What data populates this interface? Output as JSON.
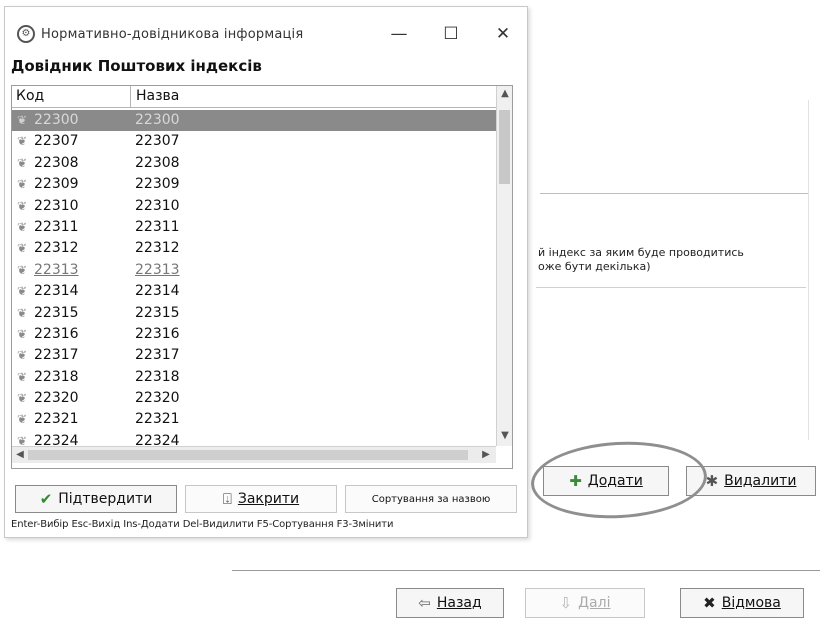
{
  "dialog": {
    "title": "Нормативно-довідникова інформація",
    "heading": "Довідник Поштових індексів",
    "window_controls": {
      "minimize": "—",
      "maximize": "☐",
      "close": "✕"
    },
    "columns": {
      "code": "Код",
      "name": "Назва"
    },
    "rows": [
      {
        "code": "22300",
        "name": "22300",
        "state": "selected"
      },
      {
        "code": "22307",
        "name": "22307"
      },
      {
        "code": "22308",
        "name": "22308"
      },
      {
        "code": "22309",
        "name": "22309"
      },
      {
        "code": "22310",
        "name": "22310"
      },
      {
        "code": "22311",
        "name": "22311"
      },
      {
        "code": "22312",
        "name": "22312"
      },
      {
        "code": "22313",
        "name": "22313",
        "state": "hover"
      },
      {
        "code": "22314",
        "name": "22314"
      },
      {
        "code": "22315",
        "name": "22315"
      },
      {
        "code": "22316",
        "name": "22316"
      },
      {
        "code": "22317",
        "name": "22317"
      },
      {
        "code": "22318",
        "name": "22318"
      },
      {
        "code": "22320",
        "name": "22320"
      },
      {
        "code": "22321",
        "name": "22321"
      },
      {
        "code": "22324",
        "name": "22324"
      }
    ],
    "buttons": {
      "confirm": "Підтвердити",
      "close": "Закрити",
      "sort": "Сортування за назвою"
    },
    "hint": "Enter-Вибір Esc-Вихід Ins-Додати Del-Видилити F5-Сортування F3-Змінити"
  },
  "wizard": {
    "hint_line1": "й індекс за яким буде проводитись",
    "hint_line2": "оже бути декілька)",
    "add": "Додати",
    "remove": "Видалити",
    "back": "Назад",
    "next": "Далі",
    "cancel": "Відмова"
  },
  "icons": {
    "app": "gear-icon",
    "row": "leaf-icon",
    "confirm": "checkmark-icon",
    "close": "door-icon",
    "add": "plus-icon",
    "remove": "star-icon",
    "back": "arrow-left-icon",
    "next": "arrow-down-icon",
    "cancel": "x-mark-icon"
  },
  "colors": {
    "selection": "#8a8a8a",
    "confirm_check": "#2e8b2e",
    "add_plus": "#3a8a3a",
    "cancel_x": "#222222"
  }
}
